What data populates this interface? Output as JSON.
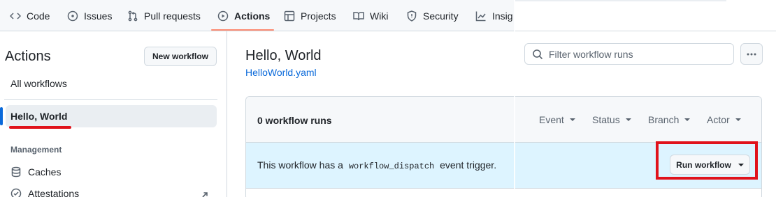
{
  "nav": {
    "tabs": [
      {
        "label": "Code",
        "icon": "code-icon"
      },
      {
        "label": "Issues",
        "icon": "issue-icon"
      },
      {
        "label": "Pull requests",
        "icon": "pull-request-icon"
      },
      {
        "label": "Actions",
        "icon": "play-icon",
        "active": true
      },
      {
        "label": "Projects",
        "icon": "table-icon"
      },
      {
        "label": "Wiki",
        "icon": "book-icon"
      },
      {
        "label": "Security",
        "icon": "shield-icon"
      },
      {
        "label": "Insig",
        "icon": "graph-icon"
      }
    ],
    "active_color": "#fd8c73"
  },
  "sidebar": {
    "title": "Actions",
    "new_workflow_label": "New workflow",
    "all_workflows_label": "All workflows",
    "selected_workflow": "Hello, World",
    "management_heading": "Management",
    "items": [
      {
        "label": "Caches",
        "icon": "database-icon"
      },
      {
        "label": "Attestations",
        "icon": "verified-icon"
      }
    ],
    "selected_accent": "#0969da"
  },
  "main": {
    "title": "Hello, World",
    "file": "HelloWorld.yaml",
    "search": {
      "placeholder": "Filter workflow runs",
      "value": ""
    },
    "runs_count": "0 workflow runs",
    "filters": [
      "Event",
      "Status",
      "Branch",
      "Actor"
    ],
    "dispatch": {
      "prefix": "This workflow has a",
      "code": "workflow_dispatch",
      "suffix": "event trigger."
    },
    "run_workflow_label": "Run workflow",
    "dispatch_background": "#ddf4ff"
  },
  "annotation_color": "#e0121b"
}
